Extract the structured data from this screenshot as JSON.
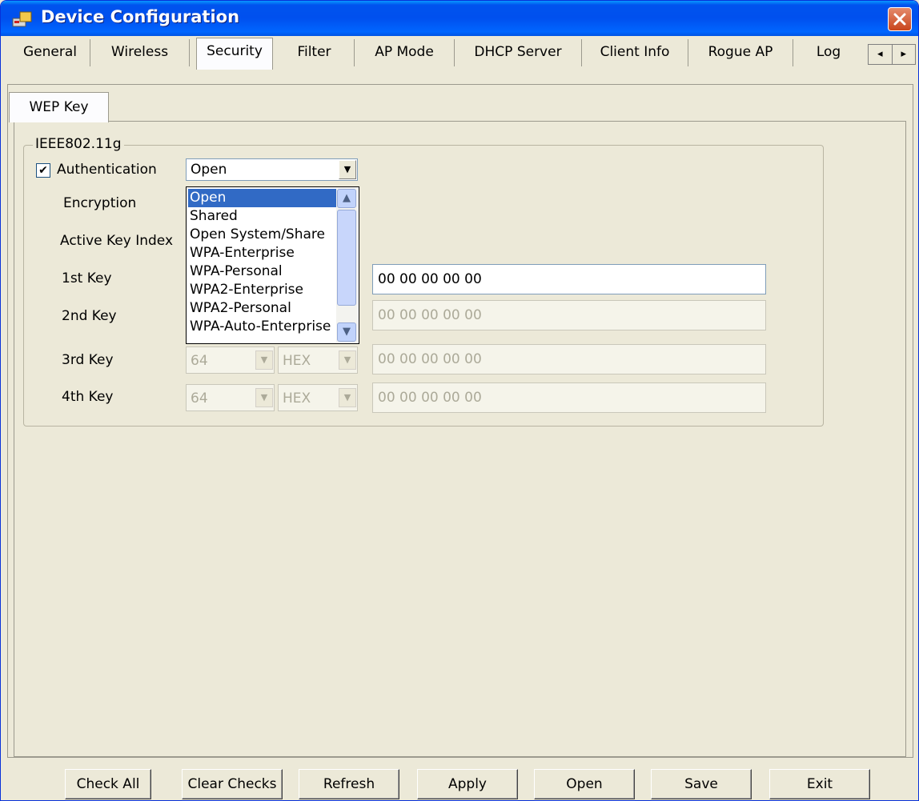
{
  "window": {
    "title": "Device Configuration",
    "close_glyph": "✕"
  },
  "tabs": [
    {
      "label": "General"
    },
    {
      "label": "Wireless"
    },
    {
      "label": "Security",
      "active": true
    },
    {
      "label": "Filter"
    },
    {
      "label": "AP Mode"
    },
    {
      "label": "DHCP Server"
    },
    {
      "label": "Client Info"
    },
    {
      "label": "Rogue AP"
    },
    {
      "label": "Log"
    }
  ],
  "tab_scroll": {
    "left_glyph": "◂",
    "right_glyph": "▸"
  },
  "subtab": {
    "label": "WEP Key"
  },
  "group": {
    "legend": "IEEE802.11g",
    "authentication": {
      "checked": true,
      "check_glyph": "✔",
      "label": "Authentication",
      "value": "Open"
    },
    "encryption_label": "Encryption",
    "active_key_index_label": "Active Key Index",
    "keys": [
      {
        "label": "1st Key",
        "value": "00 00 00 00 00",
        "enabled": true
      },
      {
        "label": "2nd Key",
        "value": "00 00 00 00 00",
        "enabled": false
      },
      {
        "label": "3rd Key",
        "length": "64",
        "format": "HEX",
        "value": "00 00 00 00 00",
        "enabled": false
      },
      {
        "label": "4th Key",
        "length": "64",
        "format": "HEX",
        "value": "00 00 00 00 00",
        "enabled": false
      }
    ]
  },
  "auth_dropdown": {
    "options": [
      "Open",
      "Shared",
      "Open System/Share",
      "WPA-Enterprise",
      "WPA-Personal",
      "WPA2-Enterprise",
      "WPA2-Personal",
      "WPA-Auto-Enterprise"
    ],
    "selected_index": 0
  },
  "combo_arrow_glyph": "▼",
  "buttons": {
    "check_all": "Check All",
    "clear_checks": "Clear Checks",
    "refresh": "Refresh",
    "apply": "Apply",
    "open": "Open",
    "save": "Save",
    "exit": "Exit"
  }
}
